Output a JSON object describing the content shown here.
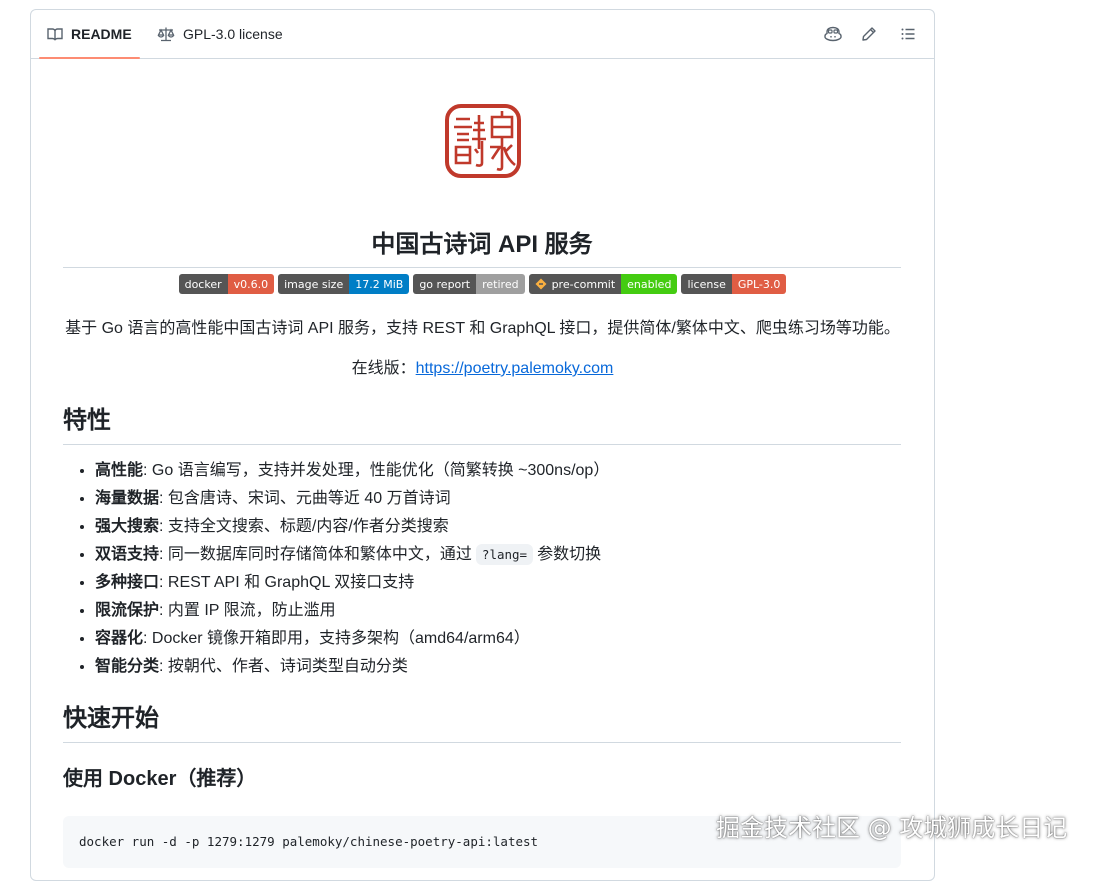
{
  "tabs": {
    "readme_label": "README",
    "license_label": "GPL-3.0 license"
  },
  "toolbar": {
    "icons": [
      "copilot-icon",
      "pencil-icon",
      "list-unordered-icon"
    ]
  },
  "logo": {
    "text": "詩泉",
    "color": "#c0392b"
  },
  "readme": {
    "title": "中国古诗词 API 服务",
    "badges": [
      {
        "left": "docker",
        "right": "v0.6.0",
        "color": "#e05d44"
      },
      {
        "left": "image size",
        "right": "17.2 MiB",
        "color": "#007ec6"
      },
      {
        "left": "go report",
        "right": "retired",
        "color": "#9f9f9f"
      },
      {
        "left": "pre-commit",
        "right": "enabled",
        "color": "#4c1"
      },
      {
        "left": "license",
        "right": "GPL-3.0",
        "color": "#e05d44"
      }
    ],
    "description": "基于 Go 语言的高性能中国古诗词 API 服务，支持 REST 和 GraphQL 接口，提供简体/繁体中文、爬虫练习场等功能。",
    "online_prefix": "在线版：",
    "online_link": "https://poetry.palemoky.com",
    "features_heading": "特性",
    "features": [
      {
        "name": "高性能",
        "text": ": Go 语言编写，支持并发处理，性能优化（简繁转换 ~300ns/op）"
      },
      {
        "name": "海量数据",
        "text": ": 包含唐诗、宋词、元曲等近 40 万首诗词"
      },
      {
        "name": "强大搜索",
        "text": ": 支持全文搜索、标题/内容/作者分类搜索"
      },
      {
        "name": "双语支持",
        "text": ": 同一数据库同时存储简体和繁体中文，通过",
        "code": "?lang=",
        "suffix": "参数切换"
      },
      {
        "name": "多种接口",
        "text": ": REST API 和 GraphQL 双接口支持"
      },
      {
        "name": "限流保护",
        "text": ": 内置 IP 限流，防止滥用"
      },
      {
        "name": "容器化",
        "text": ": Docker 镜像开箱即用，支持多架构（amd64/arm64）"
      },
      {
        "name": "智能分类",
        "text": ": 按朝代、作者、诗词类型自动分类"
      }
    ],
    "quickstart_heading": "快速开始",
    "docker_heading": "使用 Docker（推荐）",
    "docker_command": "docker run -d -p 1279:1279 palemoky/chinese-poetry-api:latest"
  },
  "watermark": "掘金技术社区 @ 攻城狮成长日记"
}
